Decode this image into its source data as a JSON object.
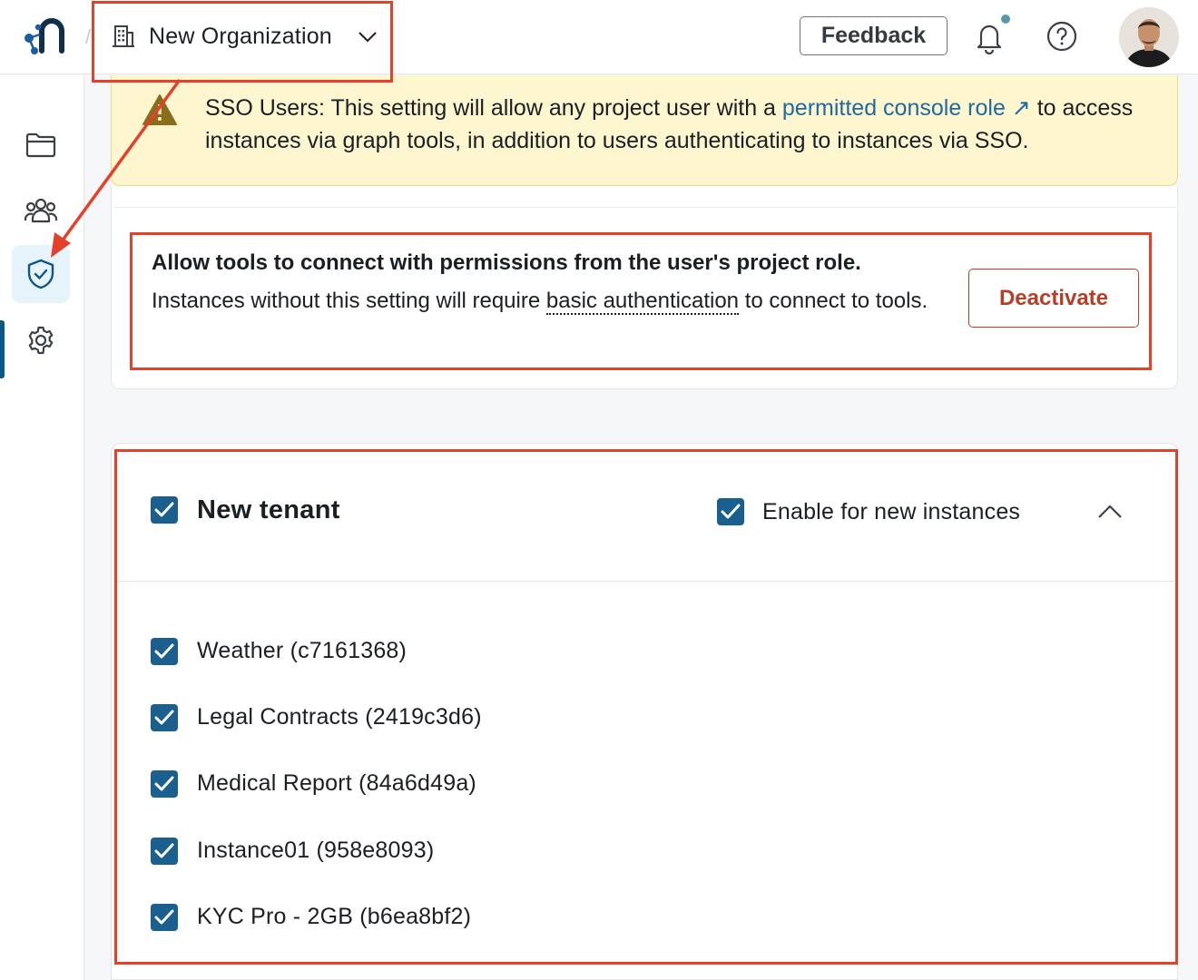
{
  "header": {
    "org_name": "New Organization",
    "feedback_label": "Feedback"
  },
  "banner": {
    "text_before": "SSO Users: This setting will allow any project user with a ",
    "link_text": "permitted console role ↗",
    "text_after": " to access instances via graph tools, in addition to users authenticating to instances via SSO."
  },
  "setting": {
    "title": "Allow tools to connect with permissions from the user's project role.",
    "desc_before": "Instances without this setting will require ",
    "desc_link": "basic authentication",
    "desc_after": " to connect to tools.",
    "deactivate_label": "Deactivate"
  },
  "tenant": {
    "name": "New tenant",
    "checked": true,
    "enable_label": "Enable for new instances",
    "enable_checked": true,
    "instances": [
      {
        "label": "Weather (c7161368)",
        "checked": true
      },
      {
        "label": "Legal Contracts (2419c3d6)",
        "checked": true
      },
      {
        "label": "Medical Report (84a6d49a)",
        "checked": true
      },
      {
        "label": "Instance01 (958e8093)",
        "checked": true
      },
      {
        "label": "KYC Pro - 2GB (b6ea8bf2)",
        "checked": true
      }
    ]
  },
  "sidebar": {
    "items": [
      {
        "icon": "folder-icon"
      },
      {
        "icon": "users-icon"
      },
      {
        "icon": "shield-check-icon",
        "active": true
      },
      {
        "icon": "gear-icon"
      }
    ]
  },
  "colors": {
    "accent": "#1b5f8e",
    "annotation": "#e2412c",
    "banner_bg": "#fdf6cf",
    "danger": "#b43e26",
    "link": "#1e6ba0"
  }
}
